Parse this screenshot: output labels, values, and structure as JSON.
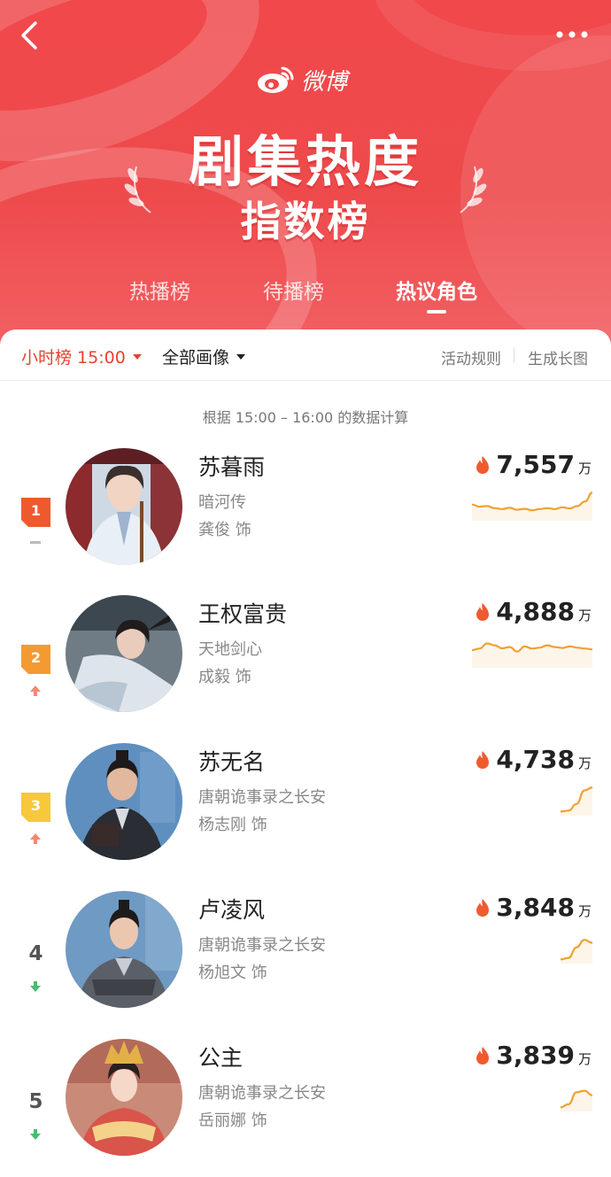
{
  "header": {
    "brand": "微博",
    "title_main": "剧集热度",
    "title_sub": "指数榜",
    "tabs": [
      {
        "label": "热播榜",
        "active": false
      },
      {
        "label": "待播榜",
        "active": false
      },
      {
        "label": "热议角色",
        "active": true
      }
    ]
  },
  "filters": {
    "hour_label": "小时榜 15:00",
    "all_label": "全部画像",
    "rules_label": "活动规则",
    "long_image_label": "生成长图"
  },
  "calc_note": "根据 15:00 – 16:00 的数据计算",
  "colors": {
    "header_red": "#ef484b",
    "accent_red": "#e8412e",
    "sparkline": "#f0a133",
    "up": "#f08a70",
    "down": "#4cba72"
  },
  "rankings": [
    {
      "rank": "1",
      "trend": "flat",
      "role": "苏暮雨",
      "drama": "暗河传",
      "actor": "龚俊 饰",
      "heat": "7,557",
      "unit": "万",
      "spark": [
        0.45,
        0.38,
        0.4,
        0.33,
        0.3,
        0.34,
        0.28,
        0.31,
        0.26,
        0.3,
        0.33,
        0.3,
        0.36,
        0.32,
        0.4,
        0.55,
        0.85
      ]
    },
    {
      "rank": "2",
      "trend": "up",
      "role": "王权富贵",
      "drama": "天地剑心",
      "actor": "成毅 饰",
      "heat": "4,888",
      "unit": "万",
      "spark": [
        0.5,
        0.55,
        0.72,
        0.66,
        0.56,
        0.6,
        0.45,
        0.62,
        0.55,
        0.58,
        0.66,
        0.6,
        0.57,
        0.62,
        0.58,
        0.55,
        0.52
      ]
    },
    {
      "rank": "3",
      "trend": "up",
      "role": "苏无名",
      "drama": "唐朝诡事录之长安",
      "actor": "杨志刚 饰",
      "heat": "4,738",
      "unit": "万",
      "spark": [
        0.05,
        0.08,
        0.3,
        0.75,
        0.85
      ]
    },
    {
      "rank": "4",
      "trend": "down",
      "role": "卢凌风",
      "drama": "唐朝诡事录之长安",
      "actor": "杨旭文 饰",
      "heat": "3,848",
      "unit": "万",
      "spark": [
        0.05,
        0.1,
        0.45,
        0.7,
        0.6
      ]
    },
    {
      "rank": "5",
      "trend": "down",
      "role": "公主",
      "drama": "唐朝诡事录之长安",
      "actor": "岳丽娜 饰",
      "heat": "3,839",
      "unit": "万",
      "spark": [
        0.05,
        0.15,
        0.55,
        0.6,
        0.45
      ]
    }
  ]
}
